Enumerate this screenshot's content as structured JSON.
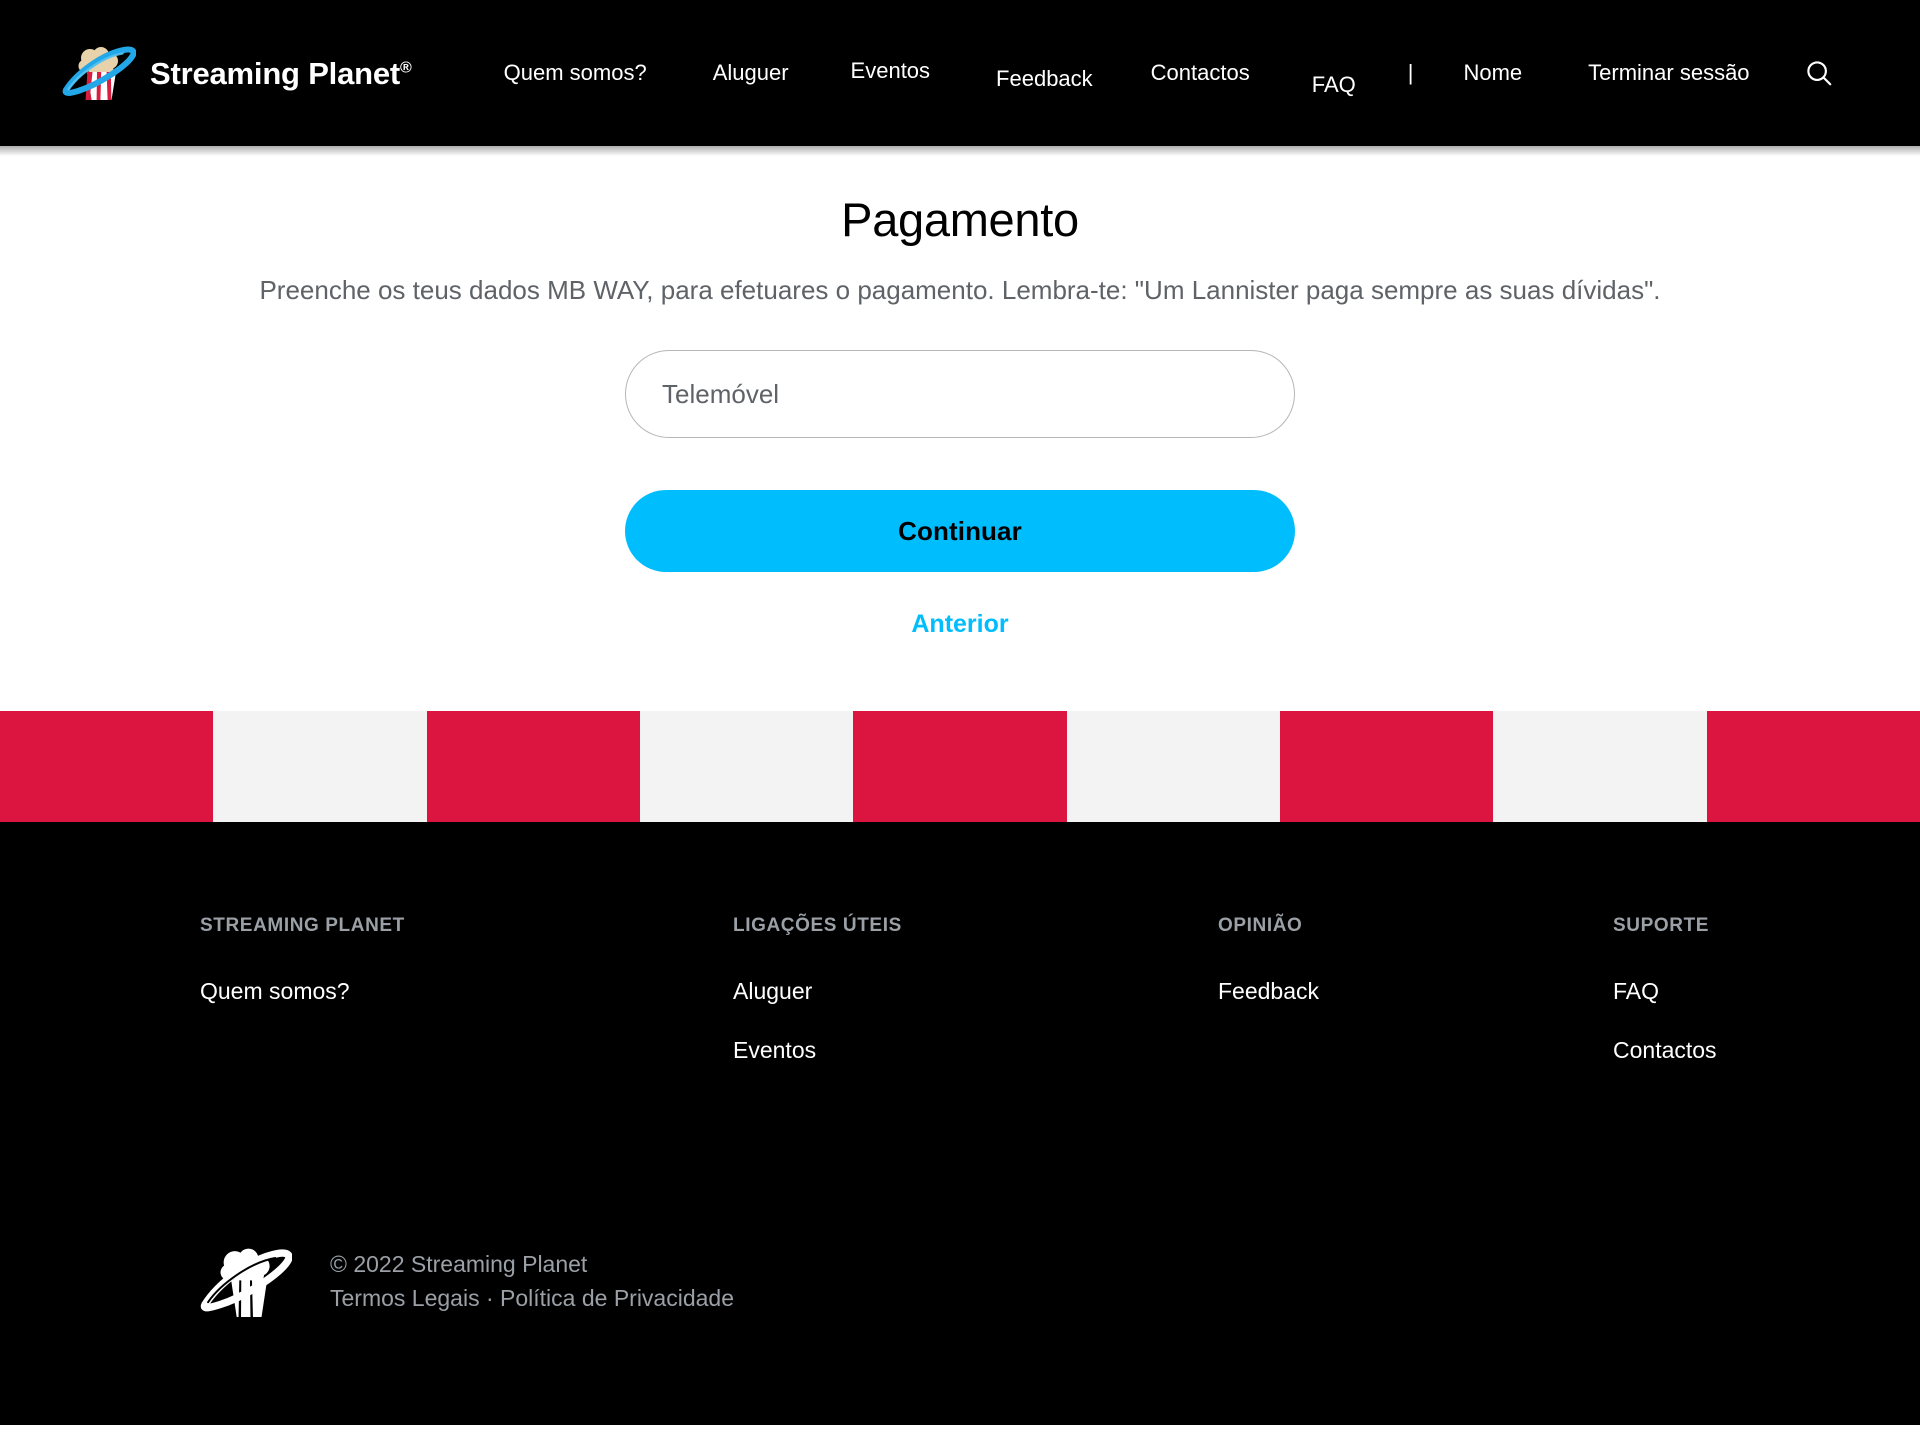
{
  "header": {
    "brand": {
      "name": "Streaming Planet",
      "registered_mark": "®",
      "logo_icon": "popcorn-planet-logo"
    },
    "nav": [
      {
        "label": "Quem somos?"
      },
      {
        "label": "Aluguer"
      },
      {
        "label": "Eventos"
      },
      {
        "label": "Feedback"
      },
      {
        "label": "Contactos"
      },
      {
        "label": "FAQ"
      },
      {
        "label": "Nome"
      },
      {
        "label": "Terminar sessão"
      }
    ],
    "separator": "|",
    "search_icon": "search-icon"
  },
  "main": {
    "title": "Pagamento",
    "subtitle": "Preenche os teus dados MB WAY, para efetuares o pagamento. Lembra-te: \"Um Lannister paga sempre as suas dívidas\".",
    "phone_field": {
      "placeholder": "Telemóvel",
      "value": ""
    },
    "continue_label": "Continuar",
    "back_label": "Anterior"
  },
  "stripes": {
    "red": "#db1540",
    "light": "#f3f3f3",
    "sequence": [
      "red",
      "light",
      "red",
      "light",
      "red",
      "light",
      "red",
      "light",
      "red"
    ]
  },
  "footer": {
    "columns": [
      {
        "title": "STREAMING PLANET",
        "links": [
          {
            "label": "Quem somos?"
          }
        ]
      },
      {
        "title": "LIGAÇÕES ÚTEIS",
        "links": [
          {
            "label": "Aluguer"
          },
          {
            "label": "Eventos"
          }
        ]
      },
      {
        "title": "OPINIÃO",
        "links": [
          {
            "label": "Feedback"
          }
        ]
      },
      {
        "title": "SUPORTE",
        "links": [
          {
            "label": "FAQ"
          },
          {
            "label": "Contactos"
          }
        ]
      }
    ],
    "logo_icon": "popcorn-planet-logo-mono",
    "copyright": "© 2022 Streaming Planet",
    "terms_label": "Termos Legais",
    "separator": "·",
    "privacy_label": "Política de Privacidade"
  },
  "colors": {
    "accent": "#00bdfe",
    "brand_red": "#db1540",
    "header_bg": "#000000",
    "muted_text": "#9aa0a6"
  }
}
